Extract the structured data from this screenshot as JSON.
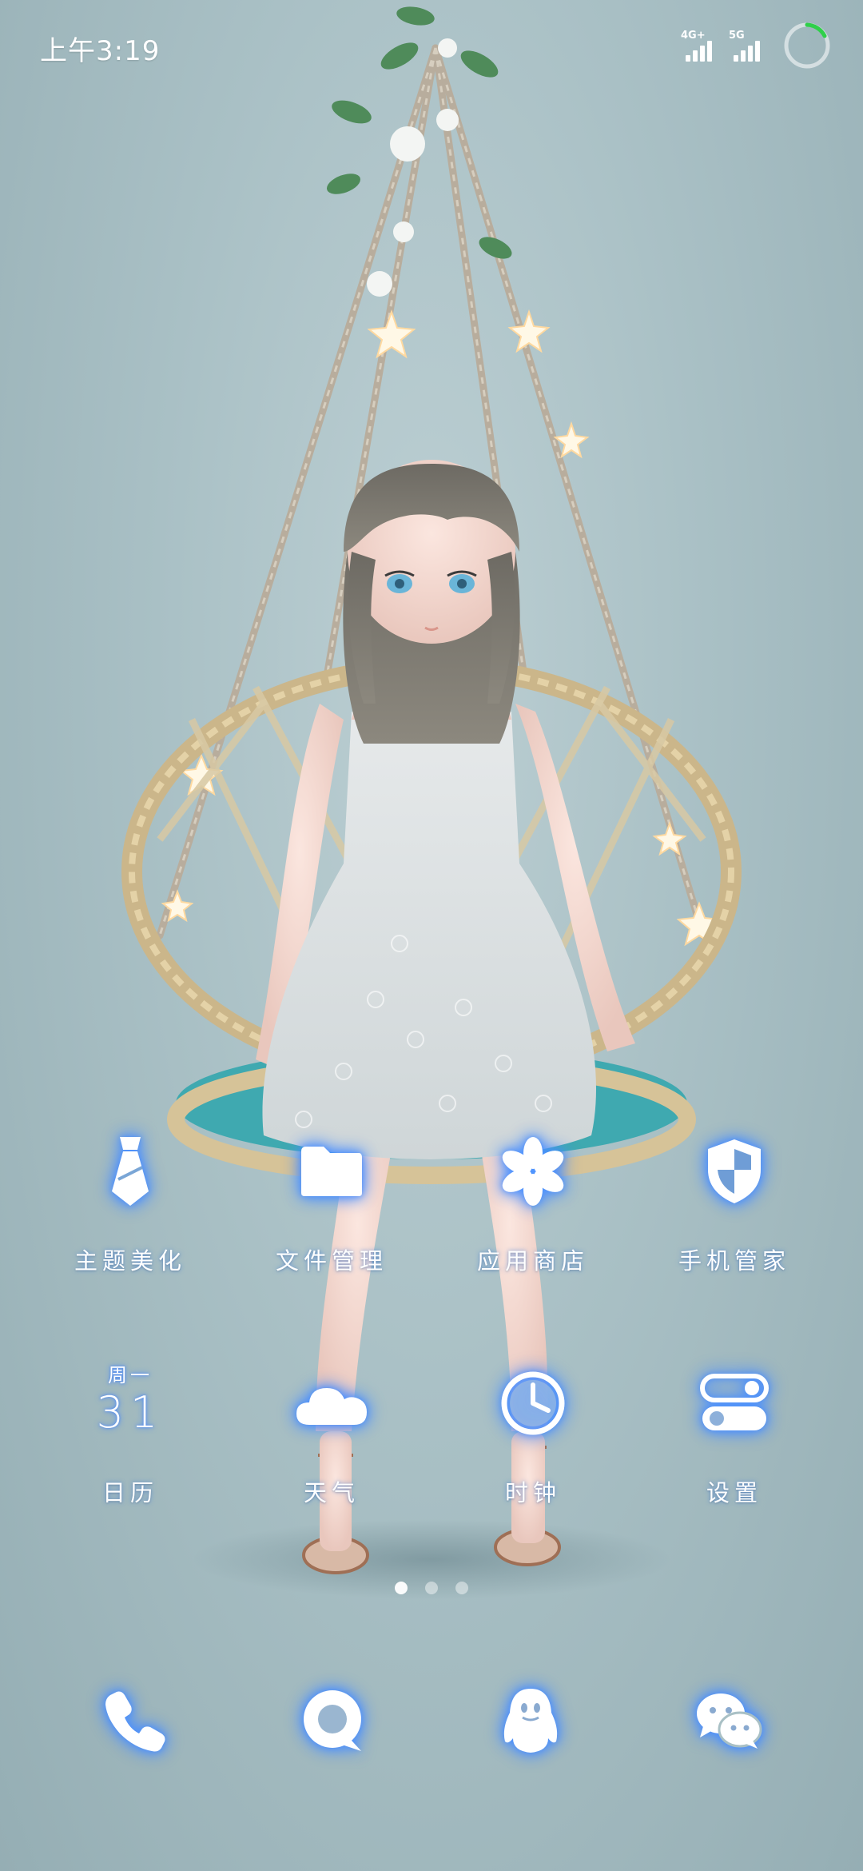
{
  "status_bar": {
    "time": "上午3:19",
    "network_1": "4G+",
    "network_2": "5G"
  },
  "home_screen": {
    "apps": [
      {
        "label": "主题美化",
        "icon": "necktie-icon"
      },
      {
        "label": "文件管理",
        "icon": "folder-icon"
      },
      {
        "label": "应用商店",
        "icon": "flower-icon"
      },
      {
        "label": "手机管家",
        "icon": "shield-icon"
      },
      {
        "label": "日历",
        "icon": "calendar-icon"
      },
      {
        "label": "天气",
        "icon": "cloud-icon"
      },
      {
        "label": "时钟",
        "icon": "clock-icon"
      },
      {
        "label": "设置",
        "icon": "toggles-icon"
      }
    ],
    "calendar": {
      "weekday": "周一",
      "day": "31"
    },
    "pages": {
      "count": 3,
      "current": 1
    }
  },
  "dock": [
    {
      "icon": "phone-icon"
    },
    {
      "icon": "message-icon"
    },
    {
      "icon": "penguin-icon"
    },
    {
      "icon": "wechat-icon"
    }
  ],
  "colors": {
    "background": "#aac1c6",
    "icon_glow": "#5096ff",
    "text": "#ffffff",
    "battery_ring": "#2fd04a"
  }
}
